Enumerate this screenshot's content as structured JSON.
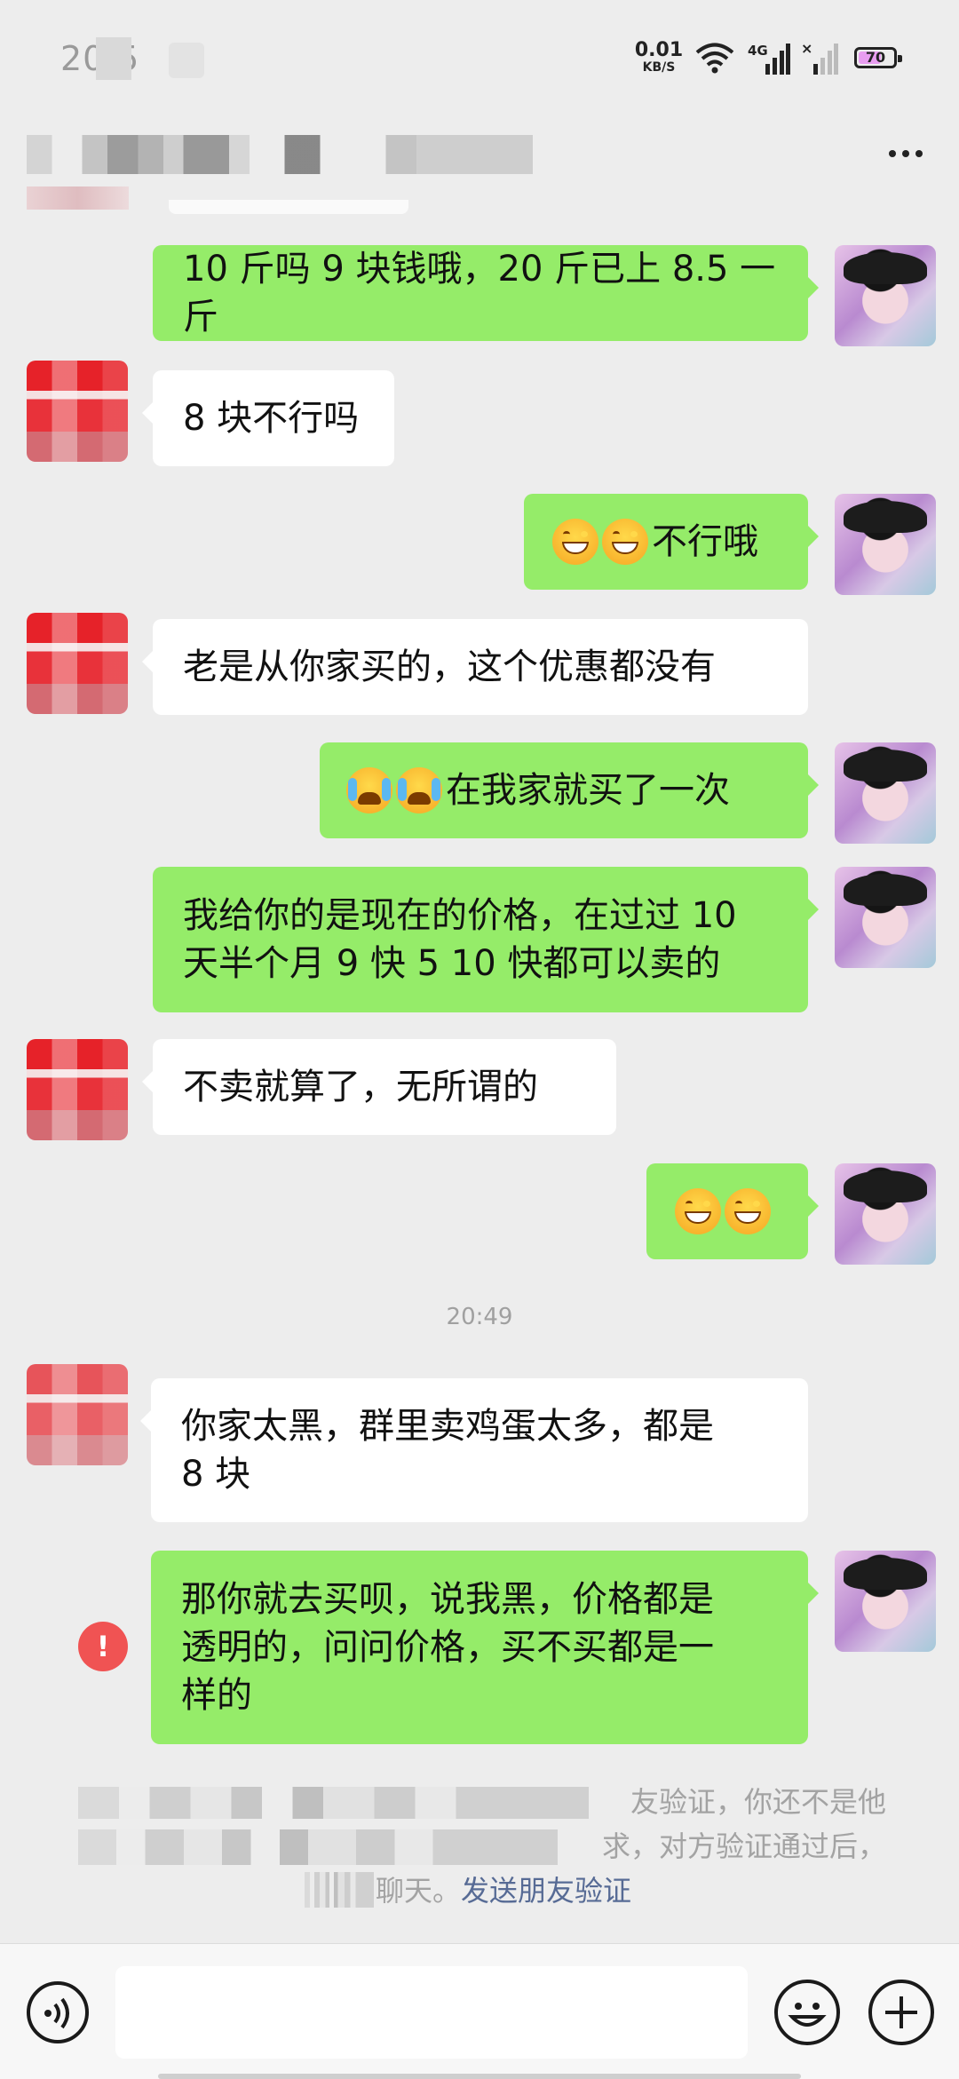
{
  "status_bar": {
    "time": "20:5",
    "net_speed_value": "0.01",
    "net_speed_unit": "KB/S",
    "network_type": "4G",
    "battery": "70",
    "battery_level_percent": 70
  },
  "header": {
    "more_icon": "more-dots-icon"
  },
  "messages": [
    {
      "side": "sent",
      "text": "10 斤吗 9 块钱哦，20 斤已上 8.5 一斤"
    },
    {
      "side": "recv",
      "text": "8 块不行吗"
    },
    {
      "side": "sent",
      "emoji": [
        "grinning-face",
        "grinning-face"
      ],
      "text": "不行哦"
    },
    {
      "side": "recv",
      "text": "老是从你家买的，这个优惠都没有"
    },
    {
      "side": "sent",
      "emoji": [
        "crying-laughing-face",
        "crying-laughing-face"
      ],
      "text": "在我家就买了一次"
    },
    {
      "side": "sent",
      "lines": [
        "我给你的是现在的价格，在过过 10",
        "天半个月 9 快 5    10 快都可以卖的"
      ]
    },
    {
      "side": "recv",
      "text": "不卖就算了，无所谓的"
    },
    {
      "side": "sent",
      "emoji": [
        "grinning-face",
        "grinning-face"
      ],
      "text": ""
    },
    {
      "side": "recv",
      "lines": [
        "你家太黑，群里卖鸡蛋太多，都是",
        "8 块"
      ]
    },
    {
      "side": "sent",
      "failed": true,
      "lines": [
        "那你就去买呗，说我黑，价格都是",
        "透明的，问问价格，买不买都是一",
        "样的"
      ]
    }
  ],
  "timestamp": "20:49",
  "system_notice": {
    "line1_visible": "友验证，你还不是他",
    "line2_visible": "求，对方验证通过后，",
    "line3_visible": "聊天。",
    "link": "发送朋友验证"
  },
  "input_bar": {
    "voice_icon": "voice-icon",
    "emoji_icon": "emoji-icon",
    "plus_icon": "plus-icon"
  },
  "colors": {
    "sent_bubble": "#95ec69",
    "recv_bubble": "#ffffff",
    "background": "#ededed",
    "link": "#576b95",
    "error": "#f05353"
  }
}
